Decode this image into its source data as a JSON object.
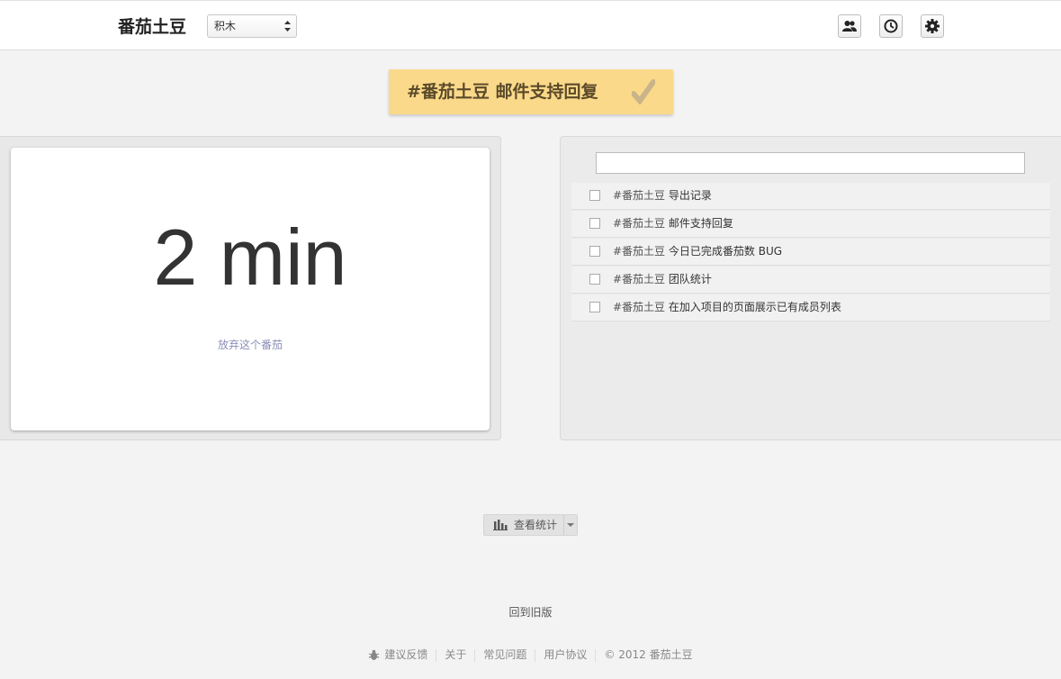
{
  "header": {
    "brand": "番茄土豆",
    "project_select_value": "积木",
    "icons": [
      "team-icon",
      "clock-icon",
      "gear-icon"
    ]
  },
  "current_task": {
    "text": "#番茄土豆 邮件支持回复"
  },
  "timer": {
    "value": "2 min",
    "abandon_label": "放弃这个番茄"
  },
  "tasks": [
    {
      "tag": "#番茄土豆",
      "title": "导出记录"
    },
    {
      "tag": "#番茄土豆",
      "title": "邮件支持回复"
    },
    {
      "tag": "#番茄土豆",
      "title": "今日已完成番茄数 BUG"
    },
    {
      "tag": "#番茄土豆",
      "title": "团队统计"
    },
    {
      "tag": "#番茄土豆",
      "title": "在加入项目的页面展示已有成员列表"
    }
  ],
  "stats": {
    "label": "查看统计"
  },
  "old_version_link": "回到旧版",
  "footer": {
    "feedback": "建议反馈",
    "about": "关于",
    "faq": "常见问题",
    "terms": "用户协议",
    "copyright": "© 2012 番茄土豆"
  },
  "colors": {
    "banner": "#fbd98a",
    "link": "#8b8fb8"
  }
}
